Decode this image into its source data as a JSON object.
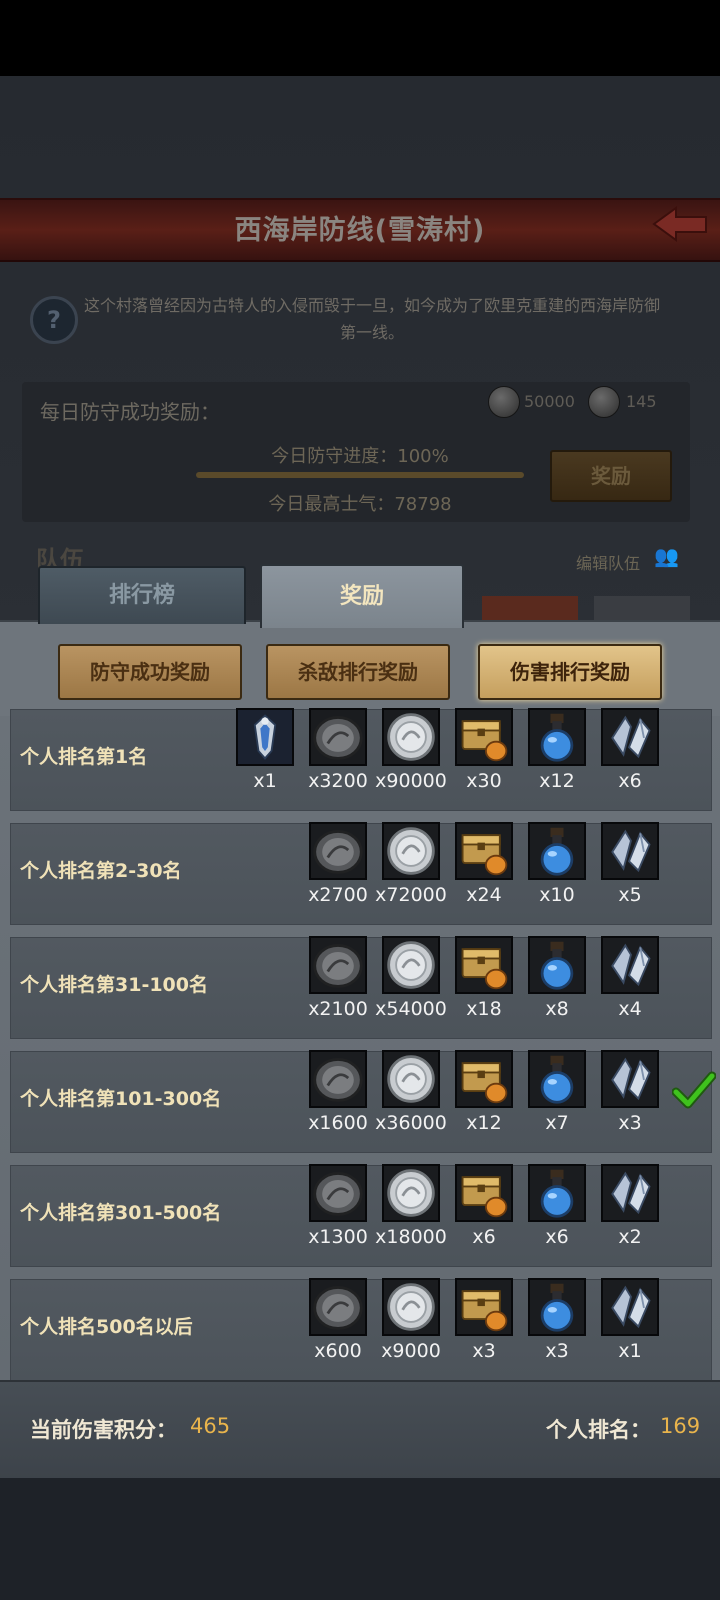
{
  "background": {
    "title": "西海岸防线(雪涛村)",
    "description": "这个村落曾经因为古特人的入侵而毁于一旦，如今成为了欧里克重建的西海岸防御第一线。",
    "daily_label": "每日防守成功奖励：",
    "daily_rewards": [
      "50000",
      "145"
    ],
    "progress_text": "今日防守进度：100%",
    "morale_text": "今日最高士气：78798",
    "reward_button": "奖励",
    "team_label": "队伍",
    "edit_team": "编辑队伍"
  },
  "tabs": [
    {
      "label": "排行榜",
      "active": false
    },
    {
      "label": "奖励",
      "active": true
    }
  ],
  "sub_tabs": [
    {
      "label": "防守成功奖励",
      "active": false
    },
    {
      "label": "杀敌排行奖励",
      "active": false
    },
    {
      "label": "伤害排行奖励",
      "active": true
    }
  ],
  "rows": [
    {
      "label": "个人排名第1名",
      "items": [
        {
          "icon": "crest-icon",
          "qty": "x1"
        },
        {
          "icon": "dark-coin-icon",
          "qty": "x3200"
        },
        {
          "icon": "silver-coin-icon",
          "qty": "x90000"
        },
        {
          "icon": "treasure-chest-icon",
          "qty": "x30"
        },
        {
          "icon": "blue-potion-icon",
          "qty": "x12"
        },
        {
          "icon": "crystal-shard-icon",
          "qty": "x6"
        }
      ],
      "claimed": false
    },
    {
      "label": "个人排名第2-30名",
      "items": [
        {
          "icon": "dark-coin-icon",
          "qty": "x2700"
        },
        {
          "icon": "silver-coin-icon",
          "qty": "x72000"
        },
        {
          "icon": "treasure-chest-icon",
          "qty": "x24"
        },
        {
          "icon": "blue-potion-icon",
          "qty": "x10"
        },
        {
          "icon": "crystal-shard-icon",
          "qty": "x5"
        }
      ],
      "claimed": false
    },
    {
      "label": "个人排名第31-100名",
      "items": [
        {
          "icon": "dark-coin-icon",
          "qty": "x2100"
        },
        {
          "icon": "silver-coin-icon",
          "qty": "x54000"
        },
        {
          "icon": "treasure-chest-icon",
          "qty": "x18"
        },
        {
          "icon": "blue-potion-icon",
          "qty": "x8"
        },
        {
          "icon": "crystal-shard-icon",
          "qty": "x4"
        }
      ],
      "claimed": false
    },
    {
      "label": "个人排名第101-300名",
      "items": [
        {
          "icon": "dark-coin-icon",
          "qty": "x1600"
        },
        {
          "icon": "silver-coin-icon",
          "qty": "x36000"
        },
        {
          "icon": "treasure-chest-icon",
          "qty": "x12"
        },
        {
          "icon": "blue-potion-icon",
          "qty": "x7"
        },
        {
          "icon": "crystal-shard-icon",
          "qty": "x3"
        }
      ],
      "claimed": true
    },
    {
      "label": "个人排名第301-500名",
      "items": [
        {
          "icon": "dark-coin-icon",
          "qty": "x1300"
        },
        {
          "icon": "silver-coin-icon",
          "qty": "x18000"
        },
        {
          "icon": "treasure-chest-icon",
          "qty": "x6"
        },
        {
          "icon": "blue-potion-icon",
          "qty": "x6"
        },
        {
          "icon": "crystal-shard-icon",
          "qty": "x2"
        }
      ],
      "claimed": false
    },
    {
      "label": "个人排名500名以后",
      "items": [
        {
          "icon": "dark-coin-icon",
          "qty": "x600"
        },
        {
          "icon": "silver-coin-icon",
          "qty": "x9000"
        },
        {
          "icon": "treasure-chest-icon",
          "qty": "x3"
        },
        {
          "icon": "blue-potion-icon",
          "qty": "x3"
        },
        {
          "icon": "crystal-shard-icon",
          "qty": "x1"
        }
      ],
      "claimed": false
    }
  ],
  "footer": {
    "score_label": "当前伤害积分：",
    "score_value": "465",
    "rank_label": "个人排名：",
    "rank_value": "169"
  },
  "colors": {
    "accent_gold": "#e9b44c",
    "check_green": "#3fc21d"
  }
}
